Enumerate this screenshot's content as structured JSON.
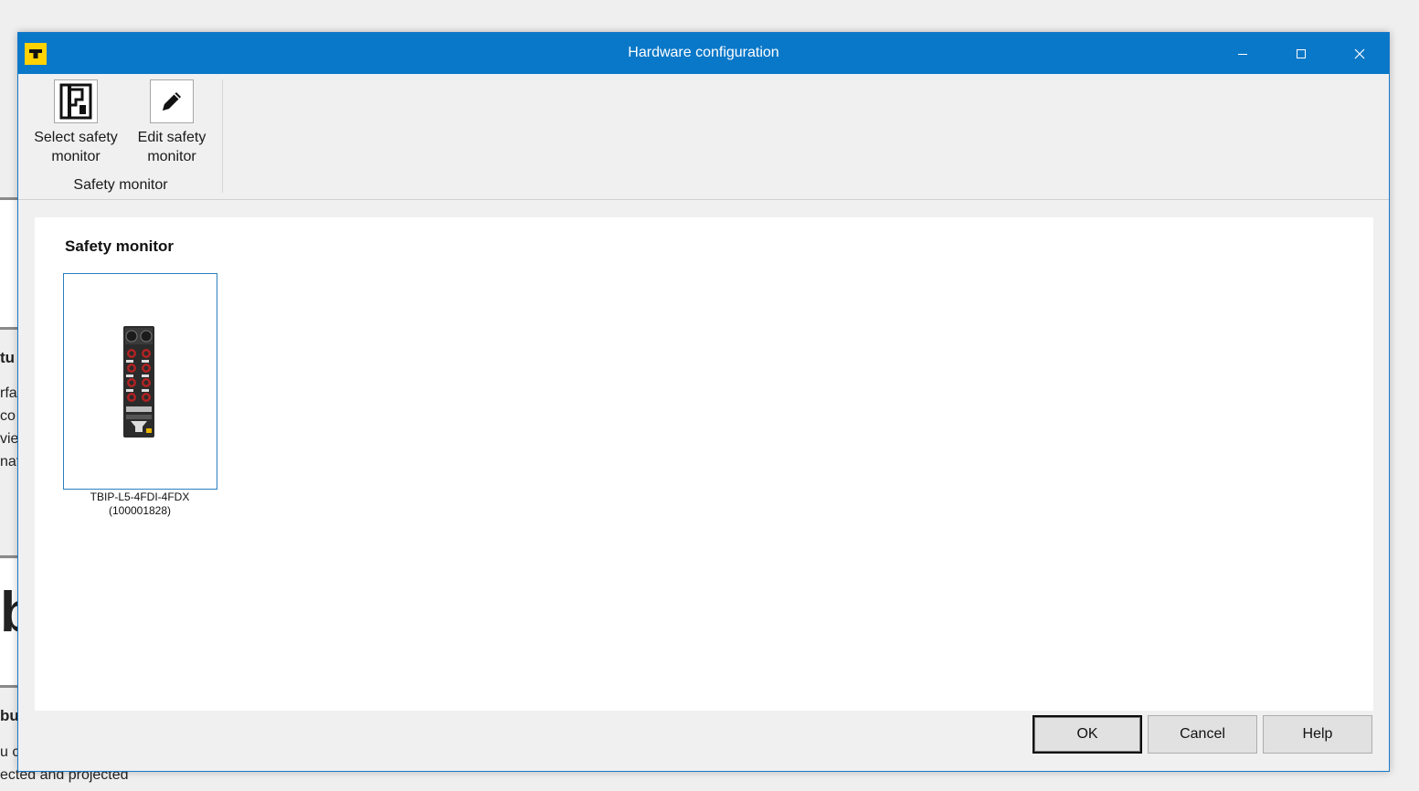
{
  "window": {
    "title": "Hardware configuration",
    "minimize_glyph": "—",
    "maximize_glyph": "☐",
    "close_glyph": "✕"
  },
  "ribbon": {
    "select_label_1": "Select safety",
    "select_label_2": "monitor",
    "edit_label_1": "Edit safety",
    "edit_label_2": "monitor",
    "group_label": "Safety monitor"
  },
  "content": {
    "section_title": "Safety monitor",
    "devices": [
      {
        "name": "TBIP-L5-4FDI-4FDX",
        "id": "(100001828)"
      }
    ]
  },
  "footer": {
    "ok_label": "OK",
    "cancel_label": "Cancel",
    "help_label": "Help"
  },
  "background_fragments": {
    "frag1": "tu",
    "frag2": "rfa",
    "frag3": "co",
    "frag4": "vie",
    "frag5": "nati",
    "frag6": "b",
    "frag7": "bu",
    "frag8": "u c",
    "frag9": "ected and projected"
  },
  "colors": {
    "titlebar": "#0a78c8",
    "accent_yellow": "#ffd200",
    "selection_border": "#2a7fbf"
  }
}
